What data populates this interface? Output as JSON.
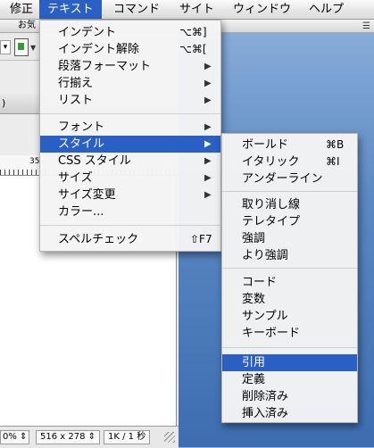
{
  "menubar": {
    "items": [
      "修正",
      "テキスト",
      "コマンド",
      "サイト",
      "ウィンドウ",
      "ヘルプ"
    ]
  },
  "background_window": {
    "toolbar_label": "お気",
    "ruler_number": "35",
    "title_fragment": ")",
    "status": {
      "zoom": "0%",
      "size": "516 x 278",
      "time": "1K / 1 秒"
    }
  },
  "text_menu": {
    "items": [
      {
        "label": "インデント",
        "shortcut": "⌥⌘]"
      },
      {
        "label": "インデント解除",
        "shortcut": "⌥⌘["
      },
      {
        "label": "段落フォーマット",
        "submenu": true
      },
      {
        "label": "行揃え",
        "submenu": true
      },
      {
        "label": "リスト",
        "submenu": true
      },
      {
        "label": "フォント",
        "submenu": true
      },
      {
        "label": "スタイル",
        "submenu": true,
        "highlighted": true
      },
      {
        "label": "CSS スタイル",
        "submenu": true
      },
      {
        "label": "サイズ",
        "submenu": true
      },
      {
        "label": "サイズ変更",
        "submenu": true
      },
      {
        "label": "カラー..."
      },
      {
        "label": "スペルチェック",
        "shortcut": "⇧F7"
      }
    ]
  },
  "style_submenu": {
    "items": [
      {
        "label": "ボールド",
        "shortcut": "⌘B"
      },
      {
        "label": "イタリック",
        "shortcut": "⌘I"
      },
      {
        "label": "アンダーライン"
      },
      {
        "label": "取り消し線"
      },
      {
        "label": "テレタイプ"
      },
      {
        "label": "強調"
      },
      {
        "label": "より強調"
      },
      {
        "label": "コード"
      },
      {
        "label": "変数"
      },
      {
        "label": "サンプル"
      },
      {
        "label": "キーボード"
      },
      {
        "label": "引用",
        "highlighted": true
      },
      {
        "label": "定義"
      },
      {
        "label": "削除済み"
      },
      {
        "label": "挿入済み"
      }
    ]
  },
  "colors": {
    "highlight": "#2a5fc4",
    "desktop": "#5b88c2"
  }
}
